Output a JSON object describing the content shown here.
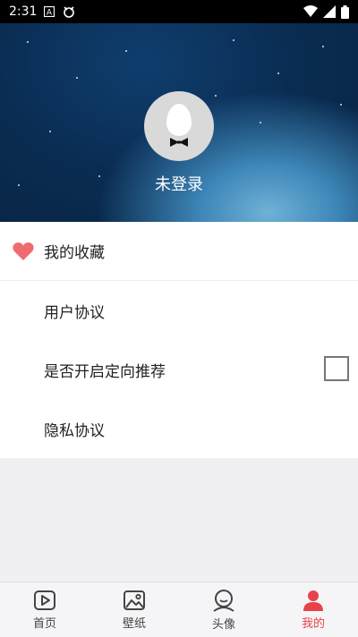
{
  "status_bar": {
    "time": "2:31",
    "left_icons": [
      "a-box-icon",
      "bug-icon"
    ],
    "right_icons": [
      "wifi-icon",
      "signal-icon",
      "battery-icon"
    ]
  },
  "profile": {
    "login_status": "未登录",
    "avatar_icon": "egg-bowtie-avatar"
  },
  "menu": {
    "favorites_label": "我的收藏",
    "user_agreement_label": "用户协议",
    "targeted_recommendation_label": "是否开启定向推荐",
    "targeted_recommendation_enabled": false,
    "privacy_label": "隐私协议"
  },
  "bottom_nav": {
    "items": [
      {
        "label": "首页",
        "icon": "play-box-icon"
      },
      {
        "label": "壁纸",
        "icon": "image-icon"
      },
      {
        "label": "头像",
        "icon": "face-icon"
      },
      {
        "label": "我的",
        "icon": "person-icon"
      }
    ],
    "active_index": 3
  },
  "colors": {
    "accent": "#e8434b",
    "heart": "#f06b70"
  }
}
